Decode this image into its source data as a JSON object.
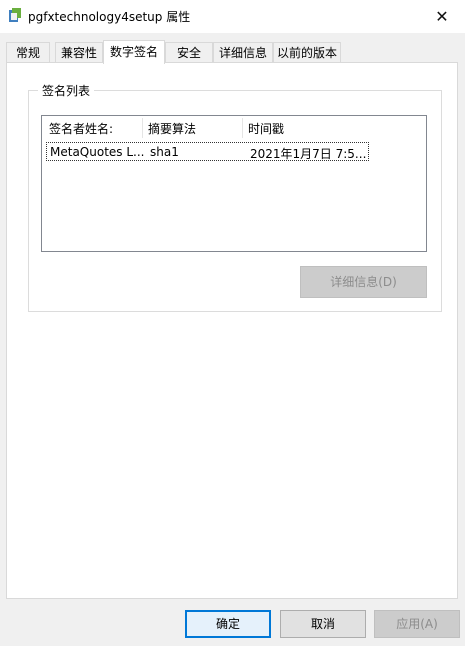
{
  "window": {
    "title": "pgfxtechnology4setup 属性",
    "close_glyph": "✕"
  },
  "tabs": [
    {
      "label": "常规"
    },
    {
      "label": "兼容性"
    },
    {
      "label": "数字签名"
    },
    {
      "label": "安全"
    },
    {
      "label": "详细信息"
    },
    {
      "label": "以前的版本"
    }
  ],
  "active_tab": "数字签名",
  "signature_group": {
    "title": "签名列表",
    "columns": [
      "签名者姓名:",
      "摘要算法",
      "时间戳"
    ],
    "rows": [
      {
        "signer": "MetaQuotes L...",
        "algorithm": "sha1",
        "timestamp": "2021年1月7日 7:5..."
      }
    ],
    "details_button": "详细信息(D)"
  },
  "footer": {
    "ok": "确定",
    "cancel": "取消",
    "apply": "应用(A)"
  },
  "colors": {
    "accent": "#0078d7",
    "disabled_bg": "#cccccc",
    "disabled_text": "#8c8c8c"
  }
}
